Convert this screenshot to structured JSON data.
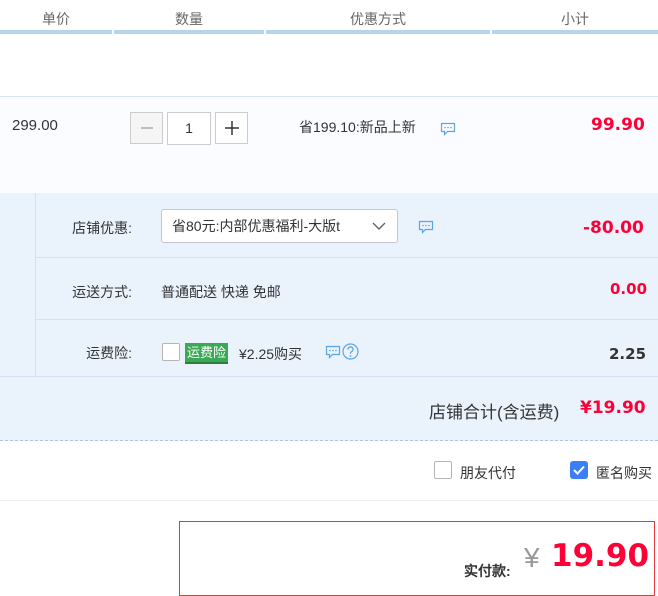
{
  "header": {
    "col_price": "单价",
    "col_qty": "数量",
    "col_discount": "优惠方式",
    "col_subtotal": "小计"
  },
  "item": {
    "price": "299.00",
    "quantity": "1",
    "promo": "省199.10:新品上新",
    "subtotal": "99.90"
  },
  "store": {
    "discount_label": "店铺优惠:",
    "discount_option": "省80元:内部优惠福利-大版t",
    "discount_amount": "-80.00",
    "shipping_label": "运送方式:",
    "shipping_value": "普通配送 快递 免邮",
    "shipping_amount": "0.00",
    "insurance_label": "运费险:",
    "insurance_tag": "运费险",
    "insurance_price": "¥2.25购买",
    "insurance_amount": "2.25",
    "total_label": "店铺合计(含运费)",
    "total_amount": "¥19.90"
  },
  "options": {
    "friend_pay": "朋友代付",
    "anonymous": "匿名购买"
  },
  "payment": {
    "label": "实付款:",
    "currency": "¥",
    "amount": "19.90"
  },
  "colors": {
    "accent_red": "#ff0036",
    "header_bar": "#b8d2f0",
    "store_bg": "#eaf2fc",
    "tag_green": "#3aa854",
    "check_blue": "#3c7ef3"
  }
}
